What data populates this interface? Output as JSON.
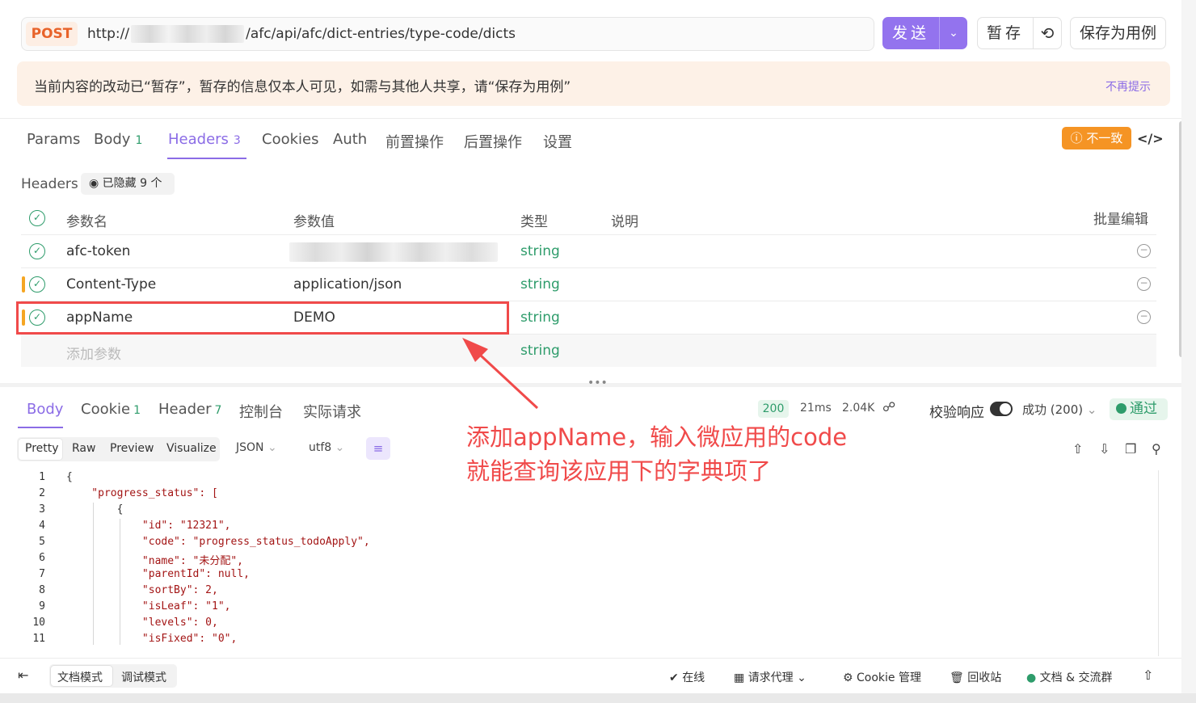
{
  "url_bar": {
    "method": "POST",
    "url_prefix": "http://",
    "url_path": "/afc/api/afc/dict-entries/type-code/dicts",
    "send_label": "发送",
    "temp_save_label": "暂存",
    "save_as_case_label": "保存为用例"
  },
  "notice": {
    "text": "当前内容的改动已“暂存”，暂存的信息仅本人可见，如需与其他人共享，请“保存为用例”",
    "dismiss_label": "不再提示"
  },
  "request_tabs": [
    {
      "label": "Params",
      "count": ""
    },
    {
      "label": "Body",
      "count": "1"
    },
    {
      "label": "Headers",
      "count": "3",
      "active": true
    },
    {
      "label": "Cookies",
      "count": ""
    },
    {
      "label": "Auth",
      "count": ""
    },
    {
      "label": "前置操作",
      "count": ""
    },
    {
      "label": "后置操作",
      "count": ""
    },
    {
      "label": "设置",
      "count": ""
    }
  ],
  "mismatch_label": "不一致",
  "headers": {
    "title": "Headers",
    "hidden_label": "已隐藏 9 个",
    "columns": {
      "name": "参数名",
      "value": "参数值",
      "type": "类型",
      "desc": "说明",
      "bulk": "批量编辑"
    },
    "rows": [
      {
        "name": "afc-token",
        "value": "",
        "type": "string"
      },
      {
        "name": "Content-Type",
        "value": "application/json",
        "type": "string"
      },
      {
        "name": "appName",
        "value": "DEMO",
        "type": "string"
      }
    ],
    "add_placeholder": "添加参数",
    "add_type": "string"
  },
  "response_tabs": [
    {
      "label": "Body",
      "count": "",
      "active": true
    },
    {
      "label": "Cookie",
      "count": "1"
    },
    {
      "label": "Header",
      "count": "7"
    },
    {
      "label": "控制台",
      "count": ""
    },
    {
      "label": "实际请求",
      "count": ""
    }
  ],
  "response_meta": {
    "status": "200",
    "time": "21ms",
    "size": "2.04K",
    "verify_label": "校验响应",
    "success_label": "成功 (200)",
    "pass_label": "通过"
  },
  "format_toolbar": {
    "modes": [
      "Pretty",
      "Raw",
      "Preview",
      "Visualize"
    ],
    "format": "JSON",
    "encoding": "utf8"
  },
  "code_lines": [
    "{",
    "    \"progress_status\": [",
    "        {",
    "            \"id\": \"12321\",",
    "            \"code\": \"progress_status_todoApply\",",
    "            \"name\": \"未分配\",",
    "            \"parentId\": null,",
    "            \"sortBy\": 2,",
    "            \"isLeaf\": \"1\",",
    "            \"levels\": 0,",
    "            \"isFixed\": \"0\","
  ],
  "annotation": {
    "line1": "添加appName，输入微应用的code",
    "line2": "就能查询该应用下的字典项了",
    "color": "#f04a4a"
  },
  "bottom_bar": {
    "doc_mode": "文档模式",
    "debug_mode": "调试模式",
    "online": "在线",
    "proxy": "请求代理",
    "cookie_manage": "Cookie 管理",
    "recycle": "回收站",
    "docs_community": "文档 & 交流群"
  },
  "colors": {
    "accent": "#9373ee",
    "success": "#2e9c6b",
    "warning": "#f59424",
    "highlight": "#f04a4a"
  }
}
